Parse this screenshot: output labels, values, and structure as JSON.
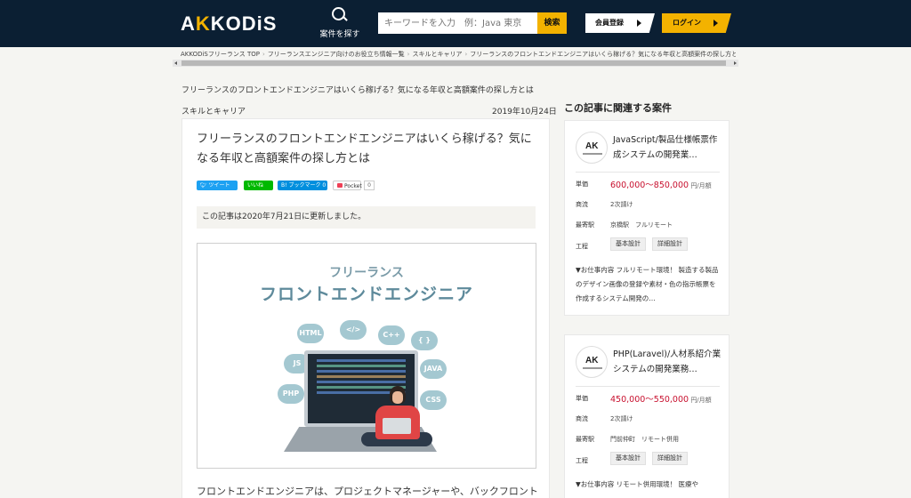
{
  "header": {
    "logo": "AKKODiS",
    "search_nav_label": "案件を探す",
    "search_placeholder": "キーワードを入力　例：Java 東京",
    "search_button": "検索",
    "register_button": "会員登録",
    "login_button": "ログイン"
  },
  "breadcrumb": [
    "AKKODiSフリーランス TOP",
    "フリーランスエンジニア向けのお役立ち情報一覧",
    "スキルとキャリア",
    "フリーランスのフロントエンドエンジニアはいくら稼げる？気になる年収と高額案件の探し方とは"
  ],
  "page_heading": "フリーランスのフロントエンドエンジニアはいくら稼げる？気になる年収と高額案件の探し方とは",
  "category": "スキルとキャリア",
  "date": "2019年10月24日",
  "article": {
    "title": "フリーランスのフロントエンドエンジニアはいくら稼げる？気になる年収と高額案件の探し方とは",
    "share": {
      "tweet": "ツイート",
      "like": "いいね",
      "hatena": "ブックマーク",
      "hatena_count": "0",
      "pocket": "Pocket",
      "pocket_count": "0"
    },
    "updated": "この記事は2020年7月21日に更新しました。",
    "hero": {
      "line1": "フリーランス",
      "line2": "フロントエンドエンジニア",
      "bubbles": [
        "HTML",
        "</>",
        "C++",
        "{ }",
        "JS",
        "JAVA",
        "PHP",
        "CSS"
      ]
    },
    "body_start": "フロントエンドエンジニアは、プロジェクトマネージャーや、バックフロントエンジ"
  },
  "sidebar": {
    "heading": "この記事に関連する案件",
    "jobs": [
      {
        "title": "JavaScript/製品仕様帳票作成システムの開発業…",
        "price_label": "単価",
        "price": "600,000～850,000",
        "price_unit": "円/月額",
        "flow_label": "商流",
        "flow": "2次請け",
        "station_label": "最寄駅",
        "station": "京橋駅　フルリモート",
        "process_label": "工程",
        "tags": [
          "基本設計",
          "詳細設計"
        ],
        "desc": "▼お仕事内容 フルリモート環境！ 製造する製品のデザイン画像の登録や素材・色の指示帳票を作成するシステム開発の…"
      },
      {
        "title": "PHP(Laravel)/人材系紹介業システムの開発業務…",
        "price_label": "単価",
        "price": "450,000～550,000",
        "price_unit": "円/月額",
        "flow_label": "商流",
        "flow": "2次請け",
        "station_label": "最寄駅",
        "station": "門前仲町　リモート併用",
        "process_label": "工程",
        "tags": [
          "基本設計",
          "詳細設計"
        ],
        "desc": "▼お仕事内容 リモート併用環境！ 医療や"
      }
    ]
  }
}
